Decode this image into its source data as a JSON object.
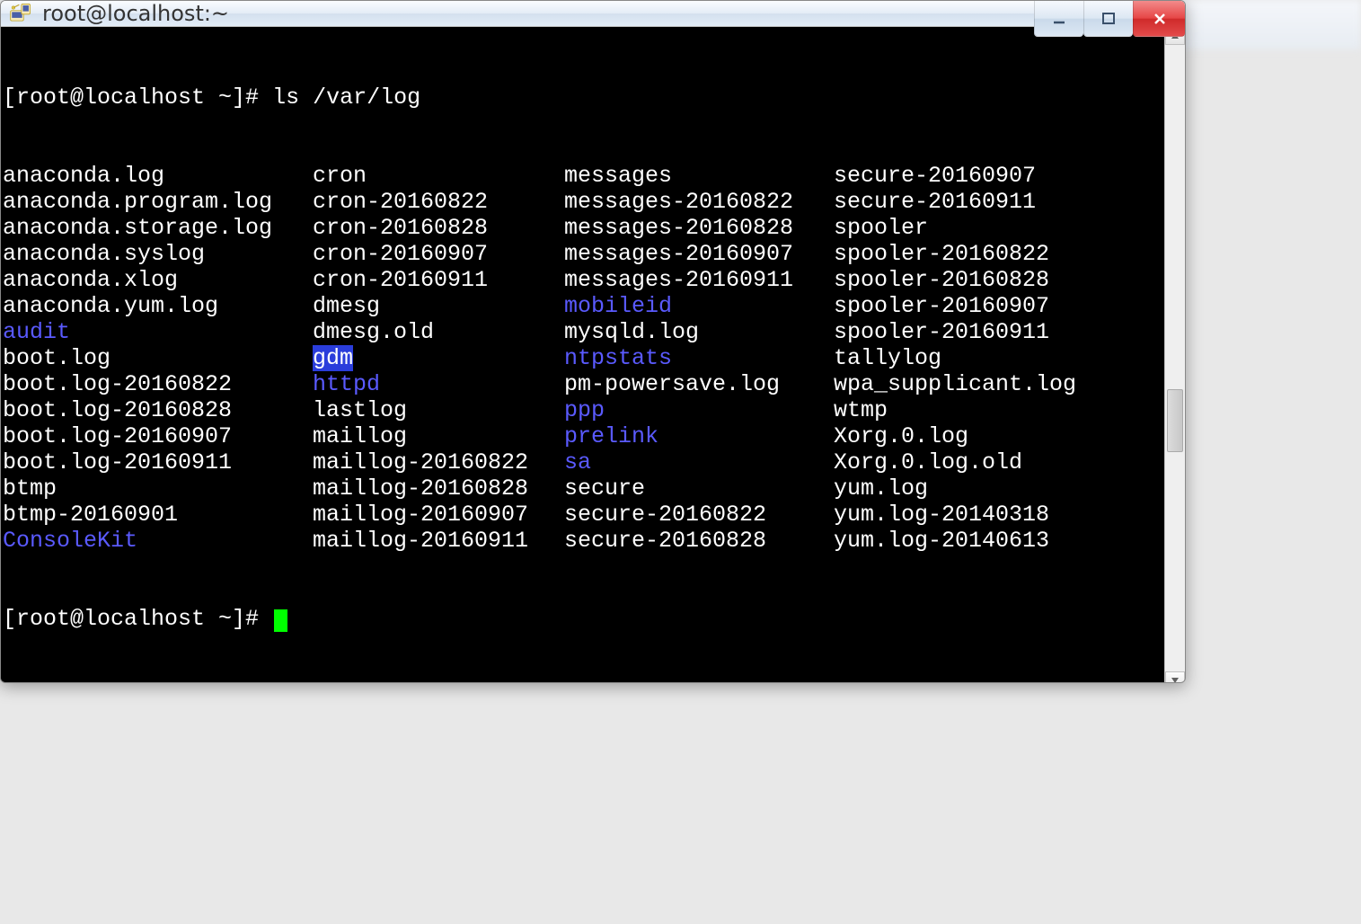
{
  "window": {
    "title": "root@localhost:~"
  },
  "terminal": {
    "prompt1": "[root@localhost ~]# ",
    "command1": "ls /var/log",
    "prompt2": "[root@localhost ~]# ",
    "columns": [
      [
        {
          "name": "anaconda.log",
          "type": "file"
        },
        {
          "name": "anaconda.program.log",
          "type": "file"
        },
        {
          "name": "anaconda.storage.log",
          "type": "file"
        },
        {
          "name": "anaconda.syslog",
          "type": "file"
        },
        {
          "name": "anaconda.xlog",
          "type": "file"
        },
        {
          "name": "anaconda.yum.log",
          "type": "file"
        },
        {
          "name": "audit",
          "type": "dir"
        },
        {
          "name": "boot.log",
          "type": "file"
        },
        {
          "name": "boot.log-20160822",
          "type": "file"
        },
        {
          "name": "boot.log-20160828",
          "type": "file"
        },
        {
          "name": "boot.log-20160907",
          "type": "file"
        },
        {
          "name": "boot.log-20160911",
          "type": "file"
        },
        {
          "name": "btmp",
          "type": "file"
        },
        {
          "name": "btmp-20160901",
          "type": "file"
        },
        {
          "name": "ConsoleKit",
          "type": "dir"
        }
      ],
      [
        {
          "name": "cron",
          "type": "file"
        },
        {
          "name": "cron-20160822",
          "type": "file"
        },
        {
          "name": "cron-20160828",
          "type": "file"
        },
        {
          "name": "cron-20160907",
          "type": "file"
        },
        {
          "name": "cron-20160911",
          "type": "file"
        },
        {
          "name": "dmesg",
          "type": "file"
        },
        {
          "name": "dmesg.old",
          "type": "file"
        },
        {
          "name": "gdm",
          "type": "dir-sel"
        },
        {
          "name": "httpd",
          "type": "dir"
        },
        {
          "name": "lastlog",
          "type": "file"
        },
        {
          "name": "maillog",
          "type": "file"
        },
        {
          "name": "maillog-20160822",
          "type": "file"
        },
        {
          "name": "maillog-20160828",
          "type": "file"
        },
        {
          "name": "maillog-20160907",
          "type": "file"
        },
        {
          "name": "maillog-20160911",
          "type": "file"
        }
      ],
      [
        {
          "name": "messages",
          "type": "file"
        },
        {
          "name": "messages-20160822",
          "type": "file"
        },
        {
          "name": "messages-20160828",
          "type": "file"
        },
        {
          "name": "messages-20160907",
          "type": "file"
        },
        {
          "name": "messages-20160911",
          "type": "file"
        },
        {
          "name": "mobileid",
          "type": "dir"
        },
        {
          "name": "mysqld.log",
          "type": "file"
        },
        {
          "name": "ntpstats",
          "type": "dir"
        },
        {
          "name": "pm-powersave.log",
          "type": "file"
        },
        {
          "name": "ppp",
          "type": "dir"
        },
        {
          "name": "prelink",
          "type": "dir"
        },
        {
          "name": "sa",
          "type": "dir"
        },
        {
          "name": "secure",
          "type": "file"
        },
        {
          "name": "secure-20160822",
          "type": "file"
        },
        {
          "name": "secure-20160828",
          "type": "file"
        }
      ],
      [
        {
          "name": "secure-20160907",
          "type": "file"
        },
        {
          "name": "secure-20160911",
          "type": "file"
        },
        {
          "name": "spooler",
          "type": "file"
        },
        {
          "name": "spooler-20160822",
          "type": "file"
        },
        {
          "name": "spooler-20160828",
          "type": "file"
        },
        {
          "name": "spooler-20160907",
          "type": "file"
        },
        {
          "name": "spooler-20160911",
          "type": "file"
        },
        {
          "name": "tallylog",
          "type": "file"
        },
        {
          "name": "wpa_supplicant.log",
          "type": "file"
        },
        {
          "name": "wtmp",
          "type": "file"
        },
        {
          "name": "Xorg.0.log",
          "type": "file"
        },
        {
          "name": "Xorg.0.log.old",
          "type": "file"
        },
        {
          "name": "yum.log",
          "type": "file"
        },
        {
          "name": "yum.log-20140318",
          "type": "file"
        },
        {
          "name": "yum.log-20140613",
          "type": "file"
        }
      ]
    ]
  }
}
